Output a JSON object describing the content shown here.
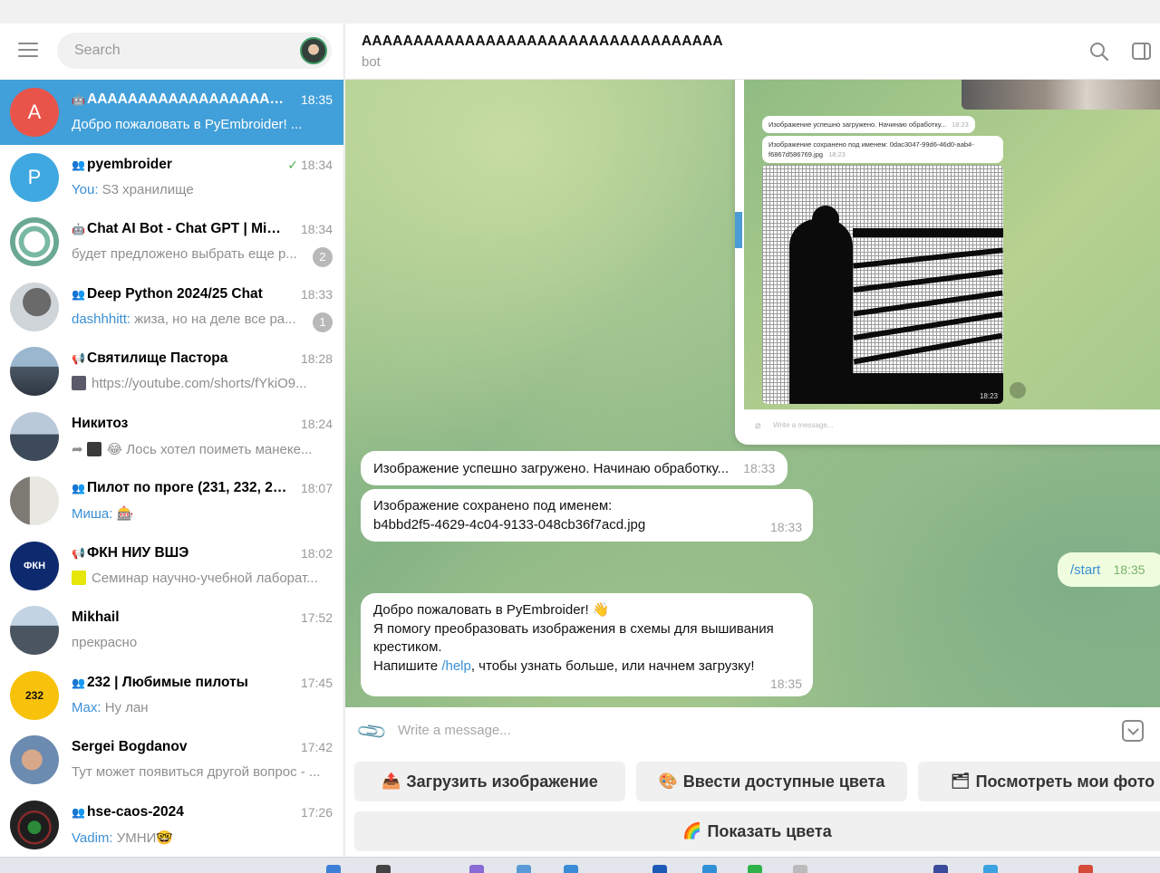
{
  "search": {
    "placeholder": "Search"
  },
  "chats": [
    {
      "title": "AAAAAAAAAAAAAAAAAAAA...",
      "time": "18:35",
      "preview": "Добро пожаловать в PyEmbroider! ...",
      "avatar_letter": "A",
      "avatar_color": "#e9544a",
      "type_icon": "bot"
    },
    {
      "title": "pyembroider",
      "time": "18:34",
      "sender": "You:",
      "preview": "S3 хранилище",
      "avatar_letter": "P",
      "avatar_color": "#40a8e0",
      "type_icon": "group",
      "read": "✓"
    },
    {
      "title": "Chat AI Bot - Chat GPT | Midjo...",
      "time": "18:34",
      "preview": "будет предложено выбрать еще р...",
      "badge": "2",
      "type_icon": "bot"
    },
    {
      "title": "Deep Python 2024/25 Chat",
      "time": "18:33",
      "sender": "dashhhitt:",
      "preview": "жиза, но на деле все ра...",
      "badge": "1",
      "type_icon": "group"
    },
    {
      "title": "Святилище Пастора",
      "time": "18:28",
      "preview": "https://youtube.com/shorts/fYkiO9...",
      "type_icon": "channel"
    },
    {
      "title": "Никитоз",
      "time": "18:24",
      "preview": "😂 Лось хотел поиметь манеке..."
    },
    {
      "title": "Пилот по проге (231, 232, 235)",
      "time": "18:07",
      "sender": "Миша:",
      "preview": "🎰",
      "type_icon": "group"
    },
    {
      "title": "ФКН НИУ ВШЭ",
      "time": "18:02",
      "preview": "Семинар научно-учебной лаборат...",
      "type_icon": "channel",
      "avatar_text": "ФКН"
    },
    {
      "title": "Mikhail",
      "time": "17:52",
      "preview": "прекрасно"
    },
    {
      "title": "232 | Любимые пилоты",
      "time": "17:45",
      "sender": "Max:",
      "preview": "Ну лан",
      "type_icon": "group",
      "avatar_text": "232"
    },
    {
      "title": "Sergei Bogdanov",
      "time": "17:42",
      "preview": "Тут может появиться другой вопрос - ..."
    },
    {
      "title": "hse-caos-2024",
      "time": "17:26",
      "sender": "Vadim:",
      "preview": "УМНИ🤓",
      "type_icon": "group"
    }
  ],
  "header": {
    "title": "AAAAAAAAAAAAAAAAAAAAAAAAAAAAAAAAAAA",
    "subtitle": "bot"
  },
  "screenshot": {
    "msg1": "Изображение успешно загружено. Начинаю обработку...",
    "msg1_time": "18:23",
    "msg2": "Изображение сохранено под именем: 0dac3047-99d6-46d0-aab4-f6867d586769.jpg",
    "msg2_time": "18:23",
    "image_time": "18:23",
    "input_placeholder": "Write a message..."
  },
  "messages": [
    {
      "text": "Изображение успешно загружено. Начинаю обработку...",
      "time": "18:33"
    },
    {
      "text_line1": "Изображение сохранено под именем:",
      "text_line2": "b4bbd2f5-4629-4c04-9133-048cb36f7acd.jpg",
      "time": "18:33"
    },
    {
      "text": "/start",
      "time": "18:35",
      "outgoing": true
    },
    {
      "line1": "Добро пожаловать в PyEmbroider! 👋",
      "line2": "Я помогу преобразовать изображения в схемы для вышивания",
      "line3": "крестиком.",
      "line4_pre": "Напишите ",
      "line4_link": "/help",
      "line4_post": ", чтобы узнать больше, или начнем загрузку!",
      "time": "18:35"
    }
  ],
  "input": {
    "placeholder": "Write a message..."
  },
  "keyboard": {
    "upload": {
      "emoji": "📤",
      "label": "Загрузить изображение"
    },
    "colors": {
      "emoji": "🎨",
      "label": "Ввести доступные цвета"
    },
    "photos": {
      "emoji": "🗂",
      "label": "Посмотреть мои фото"
    },
    "show": {
      "emoji": "🌈",
      "label": "Показать цвета"
    }
  }
}
